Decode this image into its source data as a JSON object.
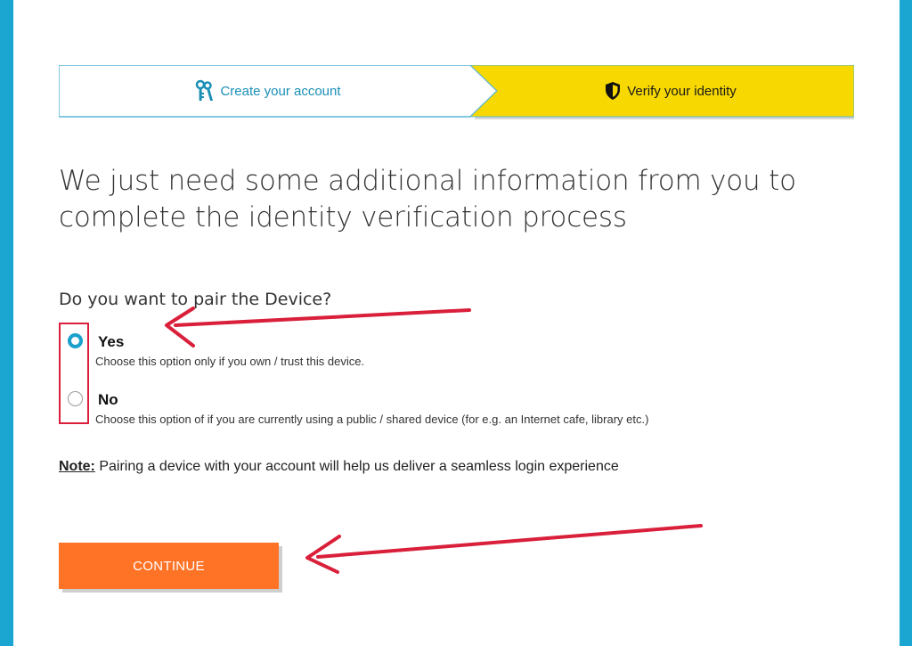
{
  "stepper": {
    "step1_label": "Create your account",
    "step2_label": "Verify your identity"
  },
  "headline": "We just need some additional information from you to complete the identity verification process",
  "question": "Do you want to pair the Device?",
  "options": [
    {
      "label": "Yes",
      "description": "Choose this option only if you own / trust this device.",
      "checked": true
    },
    {
      "label": "No",
      "description": "Choose this option of if you are currently using a public / shared device (for e.g. an Internet cafe, library etc.)",
      "checked": false
    }
  ],
  "note": {
    "label": "Note:",
    "text": " Pairing a device with your account will help us deliver a seamless login experience"
  },
  "continue_label": "CONTINUE",
  "colors": {
    "frame": "#1aa6d0",
    "step_active": "#f7d800",
    "accent_teal": "#1a8fb5",
    "button": "#ff7326",
    "annotation_red": "#d91f3a"
  },
  "icons": [
    "keys-icon",
    "shield-icon"
  ]
}
